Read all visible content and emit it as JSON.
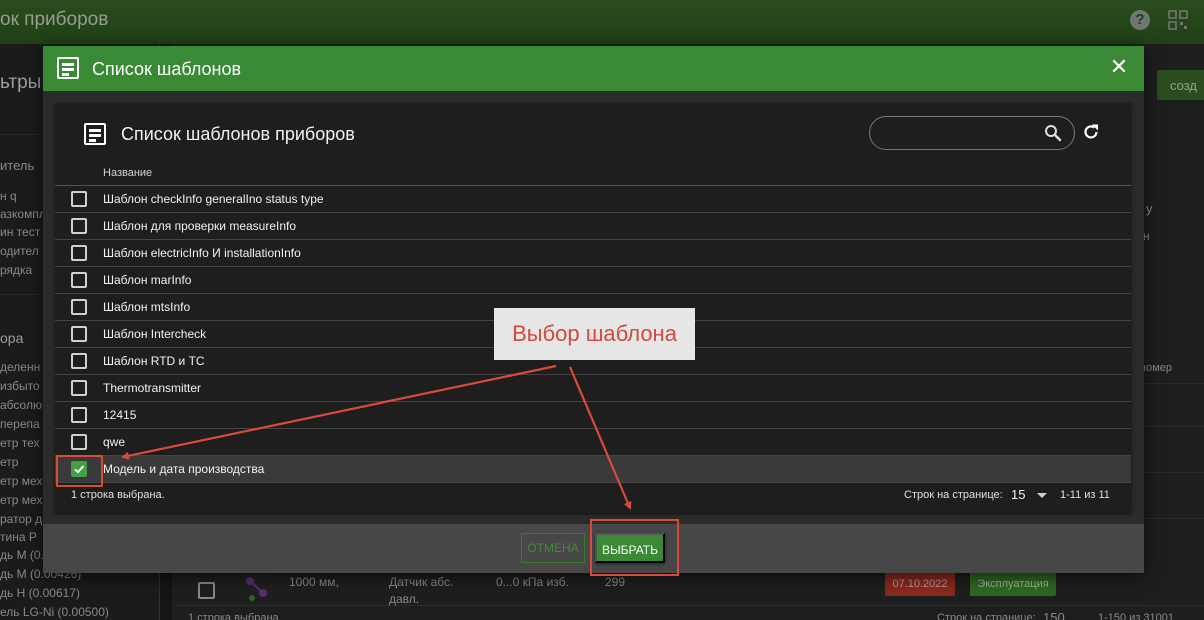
{
  "app": {
    "title": "ок приборов",
    "sidebar": {
      "filters_title": "ьтры",
      "filter_items": [
        "итель",
        "н q",
        "азкомпл",
        "ин тест",
        "одител",
        "рядка"
      ],
      "section_title": "ора",
      "section_items": [
        "деленн",
        "избыто",
        "абсолю",
        "перепа",
        "етр тех",
        "етр",
        "етр мех",
        "етр мех",
        "ратор да",
        "тина Р",
        "дь М (0.",
        "дь М (0.00426)",
        "дь Н (0.00617)",
        "ель LG-Ni (0.00500)"
      ]
    },
    "create_button": "созд",
    "side_fragments": [
      "у",
      "н"
    ],
    "column_fragment": "номер",
    "bg_row": {
      "col1_line1": "1000 мм,",
      "col2_line1": "Датчик абс.",
      "col2_line2": "давл.",
      "range": "0...0 кПа изб.",
      "serial": "299",
      "date": "07.10.2022",
      "status": "Эксплуатация"
    },
    "bg_footer": {
      "selected": "1 строка выбрана",
      "rpp_label": "Строк на странице:",
      "rpp_value": "150",
      "range": "1-150 из 31001"
    }
  },
  "dialog": {
    "title": "Список шаблонов",
    "close_label": "✕",
    "card_title": "Список шаблонов приборов",
    "search": {
      "value": "",
      "placeholder": ""
    },
    "column_header": "Название",
    "rows": [
      {
        "label": "Шаблон checkInfo generalIno status type",
        "checked": false
      },
      {
        "label": "Шаблон для проверки measureInfo",
        "checked": false
      },
      {
        "label": "Шаблон electricInfo И installationInfo",
        "checked": false
      },
      {
        "label": "Шаблон marInfo",
        "checked": false
      },
      {
        "label": "Шаблон mtsInfo",
        "checked": false
      },
      {
        "label": "Шаблон Intercheck",
        "checked": false
      },
      {
        "label": "Шаблон RTD и TC",
        "checked": false
      },
      {
        "label": "Thermotransmitter",
        "checked": false
      },
      {
        "label": "12415",
        "checked": false
      },
      {
        "label": "qwe",
        "checked": false
      },
      {
        "label": "Модель и дата производства",
        "checked": true
      }
    ],
    "footer": {
      "selected_count": "1 строка выбрана.",
      "rows_per_page_label": "Строк на странице:",
      "rows_per_page_value": "15",
      "range": "1-11 из 11"
    },
    "cancel_button": "ОТМЕНА",
    "select_button": "ВЫБРАТЬ"
  },
  "annotation": {
    "callout": "Выбор шаблона"
  },
  "colors": {
    "header_green": "#3a8a35",
    "check_green": "#43a047",
    "annotation_red": "#d94a3b",
    "date_badge_red": "#c0392b"
  }
}
